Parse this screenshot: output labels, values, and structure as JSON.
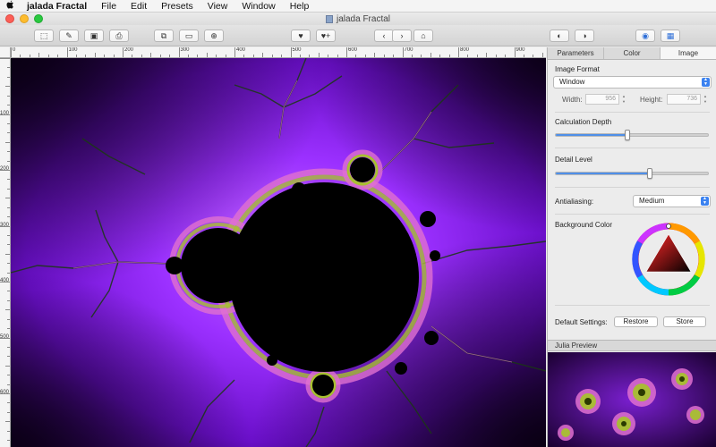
{
  "menubar": {
    "apple": "",
    "items": [
      "jalada Fractal",
      "File",
      "Edit",
      "Presets",
      "View",
      "Window",
      "Help"
    ]
  },
  "window": {
    "title": "jalada Fractal"
  },
  "toolbar": {
    "icons": [
      "export-icon",
      "edit-icon",
      "save-icon",
      "print-icon",
      "fullscreen-icon",
      "image-icon",
      "globe-icon",
      "heart-icon",
      "heart-plus-icon",
      "back-icon",
      "forward-icon",
      "home-icon",
      "zoom-in-icon",
      "zoom-out-icon",
      "eye-icon",
      "palette-icon"
    ]
  },
  "ruler": {
    "top_labels": [
      "0",
      "100",
      "200",
      "300",
      "400",
      "500",
      "600",
      "700",
      "800",
      "900"
    ],
    "left_labels": [
      "100",
      "200",
      "300",
      "400",
      "500",
      "600"
    ]
  },
  "panel": {
    "tabs": [
      "Parameters",
      "Color",
      "Image"
    ],
    "active_tab": "Image",
    "image_format_label": "Image Format",
    "image_format_value": "Window",
    "width_label": "Width:",
    "width_value": "956",
    "height_label": "Height:",
    "height_value": "736",
    "calc_depth_label": "Calculation Depth",
    "calc_depth_level": 0.47,
    "detail_level_label": "Detail Level",
    "detail_level_level": 0.62,
    "antialiasing_label": "Antialiasing:",
    "antialiasing_value": "Medium",
    "bg_color_label": "Background Color",
    "default_settings_label": "Default Settings:",
    "restore_label": "Restore",
    "store_label": "Store",
    "preview_label": "Julia Preview"
  },
  "colors": {
    "fractal_purple": "#8a1fe0",
    "fractal_pink": "#e070d0",
    "fractal_green": "#a8c030",
    "accent_blue": "#3b82f0"
  }
}
